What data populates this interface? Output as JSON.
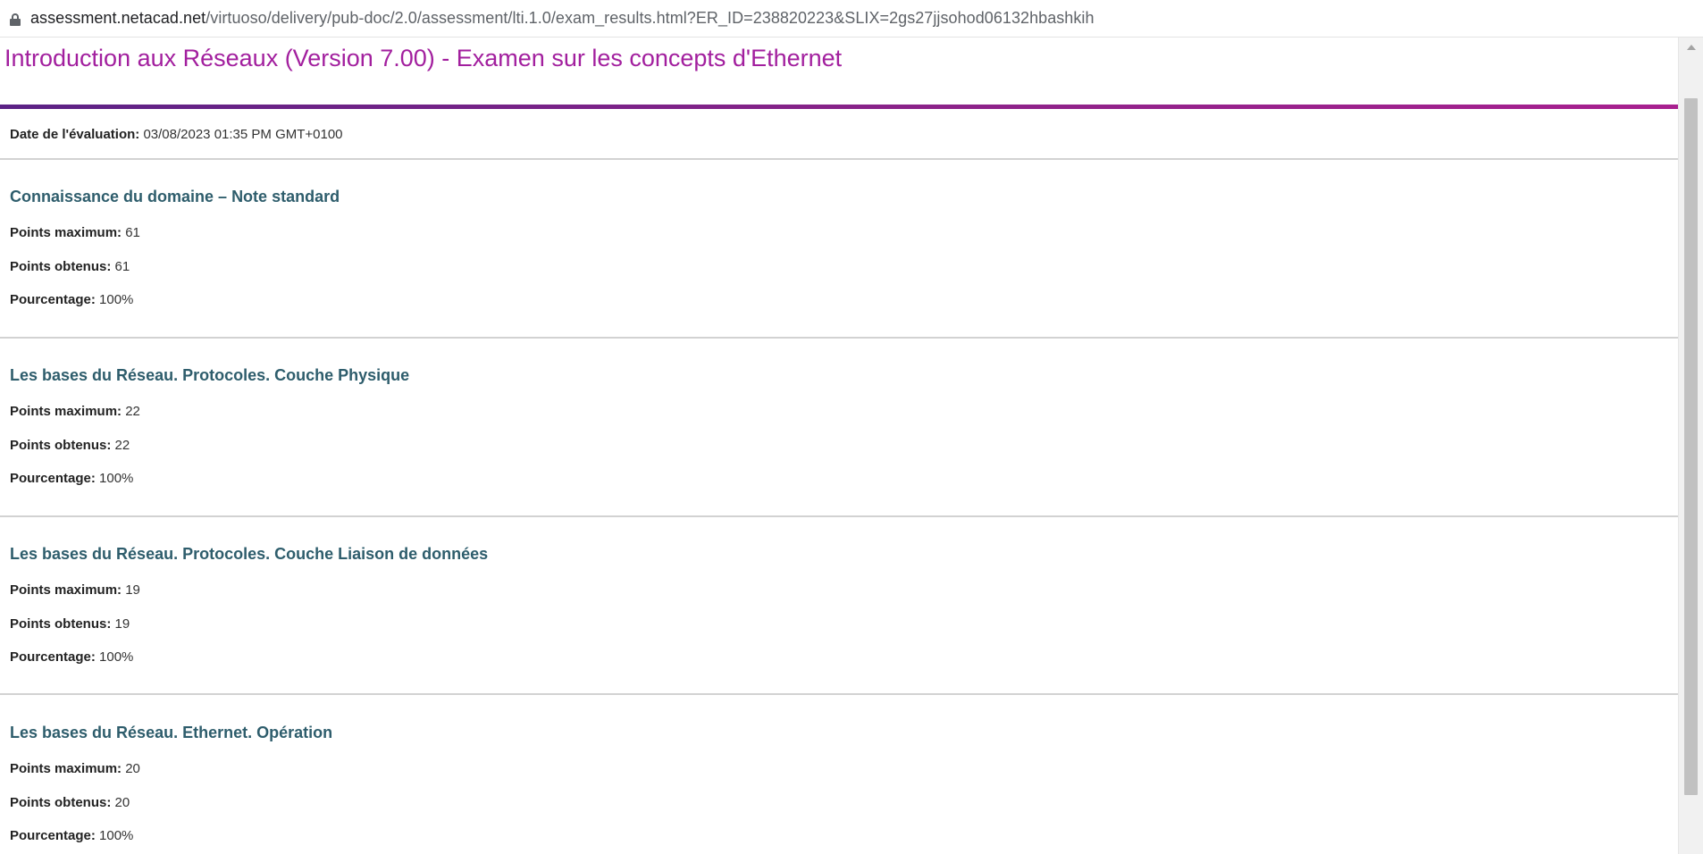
{
  "browser": {
    "url_host": "assessment.netacad.net",
    "url_path": "/virtuoso/delivery/pub-doc/2.0/assessment/lti.1.0/exam_results.html?ER_ID=238820223&SLIX=2gs27jjsohod06132hbashkih"
  },
  "page": {
    "title": "Introduction aux Réseaux (Version 7.00) - Examen sur les concepts d'Ethernet",
    "eval_date_label": "Date de l'évaluation:",
    "eval_date_value": "03/08/2023 01:35 PM GMT+0100"
  },
  "labels": {
    "max": "Points maximum:",
    "earned": "Points obtenus:",
    "percent": "Pourcentage:"
  },
  "sections": [
    {
      "title": "Connaissance du domaine – Note standard",
      "max": "61",
      "earned": "61",
      "percent": "100%"
    },
    {
      "title": "Les bases du Réseau. Protocoles. Couche Physique",
      "max": "22",
      "earned": "22",
      "percent": "100%"
    },
    {
      "title": "Les bases du Réseau. Protocoles. Couche Liaison de données",
      "max": "19",
      "earned": "19",
      "percent": "100%"
    },
    {
      "title": "Les bases du Réseau. Ethernet. Opération",
      "max": "20",
      "earned": "20",
      "percent": "100%"
    }
  ],
  "colors": {
    "title": "#a21f9e",
    "section_title": "#2e5d6c",
    "bar_start": "#5b2285",
    "bar_end": "#a8208f"
  }
}
